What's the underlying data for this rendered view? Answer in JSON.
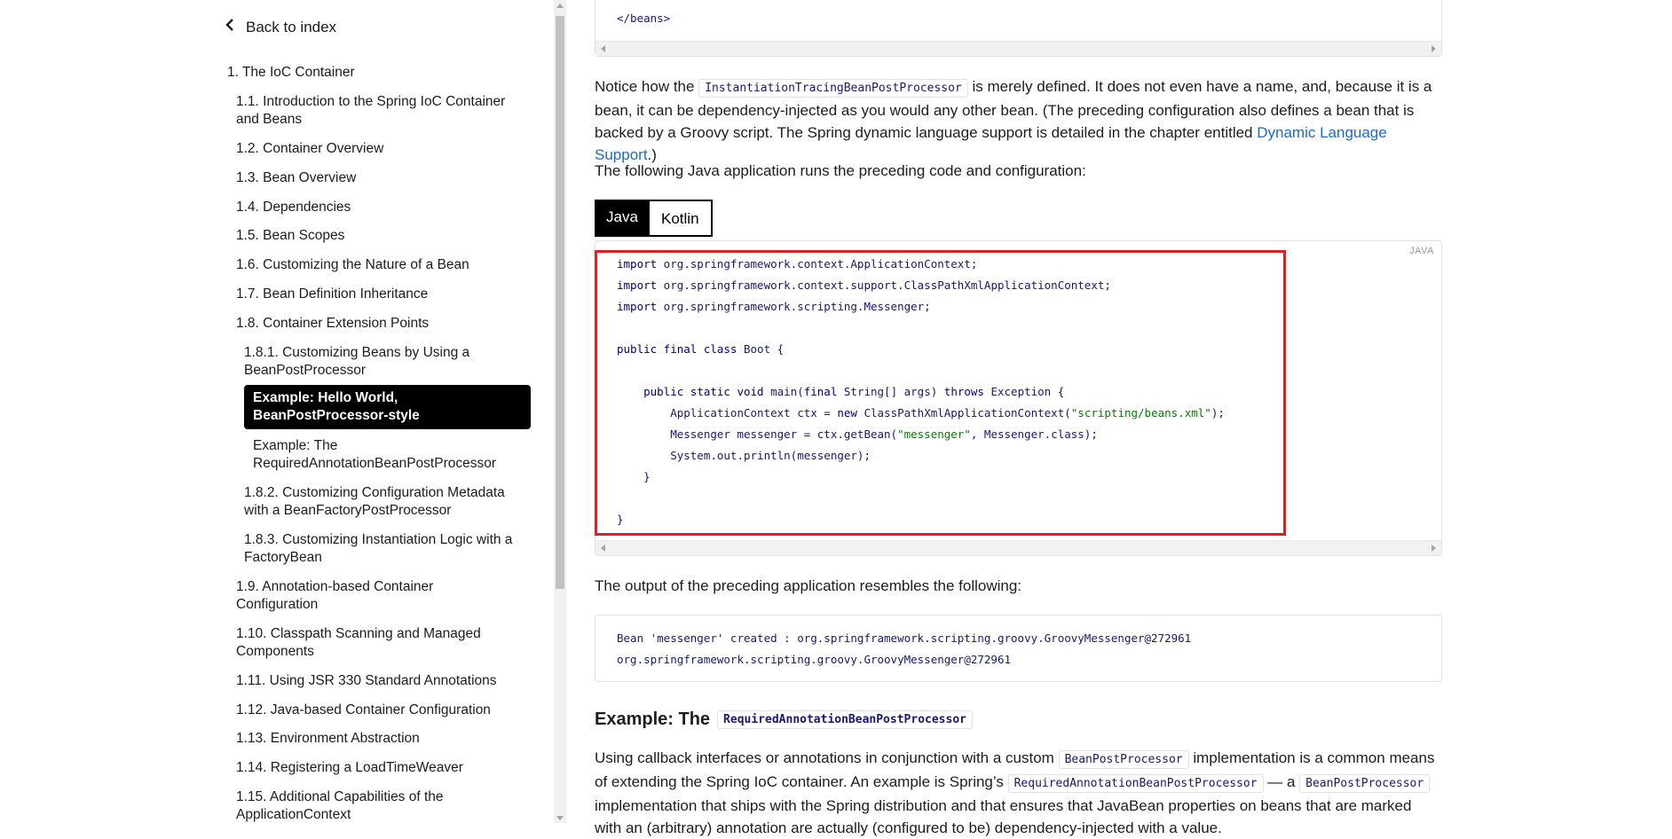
{
  "sidebar": {
    "back_label": "Back to index",
    "items": [
      {
        "label": "1. The IoC Container"
      },
      {
        "label": "1.1. Introduction to the Spring IoC Container and Beans"
      },
      {
        "label": "1.2. Container Overview"
      },
      {
        "label": "1.3. Bean Overview"
      },
      {
        "label": "1.4. Dependencies"
      },
      {
        "label": "1.5. Bean Scopes"
      },
      {
        "label": "1.6. Customizing the Nature of a Bean"
      },
      {
        "label": "1.7. Bean Definition Inheritance"
      },
      {
        "label": "1.8. Container Extension Points"
      },
      {
        "label": "1.8.1. Customizing Beans by Using a BeanPostProcessor"
      },
      {
        "label": "Example: Hello World, BeanPostProcessor-style"
      },
      {
        "label": "Example: The RequiredAnnotationBeanPostProcessor"
      },
      {
        "label": "1.8.2. Customizing Configuration Metadata with a BeanFactoryPostProcessor"
      },
      {
        "label": "1.8.3. Customizing Instantiation Logic with a FactoryBean"
      },
      {
        "label": "1.9. Annotation-based Container Configuration"
      },
      {
        "label": "1.10. Classpath Scanning and Managed Components"
      },
      {
        "label": "1.11. Using JSR 330 Standard Annotations"
      },
      {
        "label": "1.12. Java-based Container Configuration"
      },
      {
        "label": "1.13. Environment Abstraction"
      },
      {
        "label": "1.14. Registering a LoadTimeWeaver"
      },
      {
        "label": "1.15. Additional Capabilities of the ApplicationContext"
      }
    ]
  },
  "main": {
    "top_code_line": "</beans>",
    "para1": {
      "before": "Notice how the ",
      "code": "InstantiationTracingBeanPostProcessor",
      "after": " is merely defined. It does not even have a name, and, because it is a bean, it can be dependency-injected as you would any other bean. (The preceding configuration also defines a bean that is backed by a Groovy script. The Spring dynamic language support is detailed in the chapter entitled ",
      "link": "Dynamic Language Support",
      "end": ".)"
    },
    "para2": "The following Java application runs the preceding code and configuration:",
    "tabs": [
      "Java",
      "Kotlin"
    ],
    "code_lang_label": "JAVA",
    "code_lines": [
      [
        {
          "t": "import",
          "c": "kw"
        },
        {
          "t": " org.springframework.context.ApplicationContext;"
        }
      ],
      [
        {
          "t": "import",
          "c": "kw"
        },
        {
          "t": " org.springframework.context.support.ClassPathXmlApplicationContext;"
        }
      ],
      [
        {
          "t": "import",
          "c": "kw"
        },
        {
          "t": " org.springframework.scripting.Messenger;"
        }
      ],
      [
        {
          "t": ""
        }
      ],
      [
        {
          "t": "public final class",
          "c": "kw"
        },
        {
          "t": " Boot {"
        }
      ],
      [
        {
          "t": ""
        }
      ],
      [
        {
          "t": "    "
        },
        {
          "t": "public static void",
          "c": "kw"
        },
        {
          "t": " main("
        },
        {
          "t": "final",
          "c": "kw"
        },
        {
          "t": " String[] args) "
        },
        {
          "t": "throws",
          "c": "kw"
        },
        {
          "t": " Exception {"
        }
      ],
      [
        {
          "t": "        ApplicationContext ctx = "
        },
        {
          "t": "new",
          "c": "kw"
        },
        {
          "t": " ClassPathXmlApplicationContext("
        },
        {
          "t": "\"scripting/beans.xml\"",
          "c": "str"
        },
        {
          "t": ");"
        }
      ],
      [
        {
          "t": "        Messenger messenger = ctx.getBean("
        },
        {
          "t": "\"messenger\"",
          "c": "str"
        },
        {
          "t": ", Messenger.class);"
        }
      ],
      [
        {
          "t": "        System.out.println(messenger);"
        }
      ],
      [
        {
          "t": "    }"
        }
      ],
      [
        {
          "t": ""
        }
      ],
      [
        {
          "t": "}"
        }
      ]
    ],
    "para3": "The output of the preceding application resembles the following:",
    "output_lines": [
      "Bean 'messenger' created : org.springframework.scripting.groovy.GroovyMessenger@272961",
      "org.springframework.scripting.groovy.GroovyMessenger@272961"
    ],
    "heading": {
      "text": "Example: The",
      "code": "RequiredAnnotationBeanPostProcessor"
    },
    "para4": {
      "s1": "Using callback interfaces or annotations in conjunction with a custom ",
      "c1": "BeanPostProcessor",
      "s2": " implementation is a common means of extending the Spring IoC container. An example is Spring’s ",
      "c2": "RequiredAnnotationBeanPostProcessor",
      "s3": " — a ",
      "c3": "BeanPostProcessor",
      "s4": " implementation that ships with the Spring distribution and that ensures that JavaBean properties on beans that are marked with an (arbitrary) annotation are actually (configured to be) dependency-injected with a value."
    }
  }
}
